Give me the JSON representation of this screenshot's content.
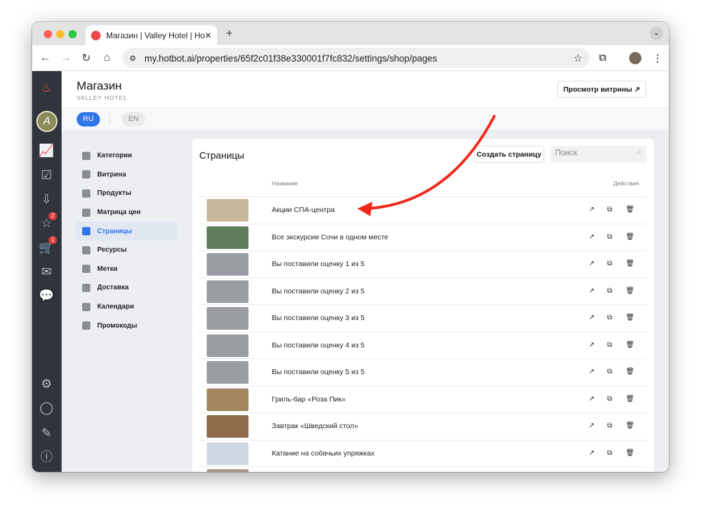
{
  "browser": {
    "tab_title": "Магазин | Valley Hotel | Hotbot",
    "url": "my.hotbot.ai/properties/65f2c01f38e330001f7fc832/settings/shop/pages"
  },
  "rail": {
    "badges": {
      "reviews": "2",
      "cart": "1"
    }
  },
  "header": {
    "title": "Магазин",
    "subtitle": "VALLEY HOTEL",
    "view_button": "Просмотр витрины ↗"
  },
  "languages": [
    "RU",
    "EN"
  ],
  "sidebar": {
    "items": [
      {
        "label": "Категории"
      },
      {
        "label": "Витрина"
      },
      {
        "label": "Продукты"
      },
      {
        "label": "Матрица цен"
      },
      {
        "label": "Страницы",
        "active": true
      },
      {
        "label": "Ресурсы"
      },
      {
        "label": "Метки"
      },
      {
        "label": "Доставка"
      },
      {
        "label": "Календари"
      },
      {
        "label": "Промокоды"
      }
    ]
  },
  "card": {
    "title": "Страницы",
    "create_button": "Создать страницу",
    "search_placeholder": "Поиск",
    "col_name": "Название",
    "col_actions": "Действия",
    "rows": [
      {
        "name": "Акции СПА-центра",
        "thumb": "#c9b79a"
      },
      {
        "name": "Все экскурсии Сочи в одном месте",
        "thumb": "#5f7d5a"
      },
      {
        "name": "Вы поставили оценку 1 из 5",
        "thumb": "#9a9da2"
      },
      {
        "name": "Вы поставили оценку 2 из 5",
        "thumb": "#9a9da2"
      },
      {
        "name": "Вы поставили оценку 3 из 5",
        "thumb": "#9a9da2"
      },
      {
        "name": "Вы поставили оценку 4 из 5",
        "thumb": "#9a9da2"
      },
      {
        "name": "Вы поставили оценку 5 из 5",
        "thumb": "#9a9da2"
      },
      {
        "name": "Гриль-бар «Роза Пик»",
        "thumb": "#a0855e"
      },
      {
        "name": "Завтрак «Шведский стол»",
        "thumb": "#8f6a4a"
      },
      {
        "name": "Катание на собачьих упряжках",
        "thumb": "#cfd8e2"
      },
      {
        "name": "",
        "thumb": "#a89a88"
      }
    ]
  },
  "colors": {
    "accent": "#2f74e8",
    "rail": "#30343c",
    "annotation": "#f02a1a"
  }
}
